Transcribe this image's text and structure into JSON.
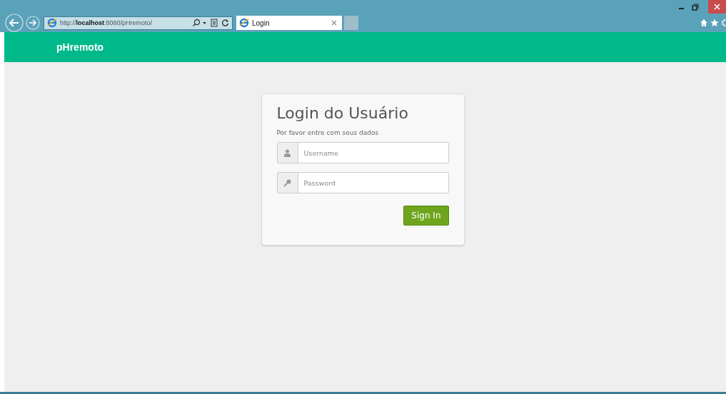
{
  "browser": {
    "address": "http://**localhost**:8080/pHremoto/",
    "tabs": [
      {
        "label": "Login",
        "selected": true
      }
    ]
  },
  "navbar": {
    "brand": "pHremoto"
  },
  "login": {
    "title": "Login do Usuário",
    "subtitle": "Por favor entre com seus dados",
    "fields": [
      {
        "kind": "user",
        "placeholder": "Username"
      },
      {
        "kind": "key",
        "placeholder": "Password"
      }
    ],
    "button": "Sign In"
  }
}
